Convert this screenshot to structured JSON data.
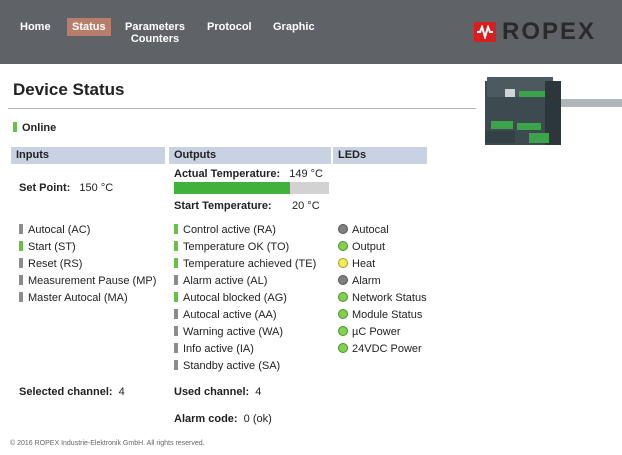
{
  "nav": {
    "items": [
      {
        "label": "Home",
        "active": false
      },
      {
        "label": "Status",
        "active": true
      },
      {
        "label": "Parameters\nCounters",
        "active": false
      },
      {
        "label": "Protocol",
        "active": false
      },
      {
        "label": "Graphic",
        "active": false
      }
    ]
  },
  "brand": {
    "logo_text": "ROPEX",
    "logo_color": "#d81e1e"
  },
  "page": {
    "title": "Device Status",
    "online_label": "Online"
  },
  "columns": {
    "inputs": "Inputs",
    "outputs": "Outputs",
    "leds": "LEDs"
  },
  "setpoint": {
    "label": "Set Point:",
    "value": "150 °C"
  },
  "temperature": {
    "actual_label": "Actual Temperature:",
    "actual_value": "149 °C",
    "start_label": "Start Temperature:",
    "start_value": "20 °C",
    "bar_fraction": 0.75
  },
  "inputs": [
    {
      "label": "Autocal (AC)",
      "state": "gray"
    },
    {
      "label": "Start (ST)",
      "state": "green"
    },
    {
      "label": "Reset (RS)",
      "state": "gray"
    },
    {
      "label": "Measurement Pause (MP)",
      "state": "gray"
    },
    {
      "label": "Master Autocal (MA)",
      "state": "gray"
    }
  ],
  "outputs": [
    {
      "label": "Control active (RA)",
      "state": "green"
    },
    {
      "label": "Temperature OK (TO)",
      "state": "green"
    },
    {
      "label": "Temperature achieved (TE)",
      "state": "green"
    },
    {
      "label": "Alarm active (AL)",
      "state": "gray"
    },
    {
      "label": "Autocal blocked (AG)",
      "state": "green"
    },
    {
      "label": "Autocal active (AA)",
      "state": "gray"
    },
    {
      "label": "Warning active (WA)",
      "state": "gray"
    },
    {
      "label": "Info active (IA)",
      "state": "gray"
    },
    {
      "label": "Standby active (SA)",
      "state": "gray"
    }
  ],
  "leds": [
    {
      "label": "Autocal",
      "color": "#7f7f7f"
    },
    {
      "label": "Output",
      "color": "#7dd34a"
    },
    {
      "label": "Heat",
      "color": "#f2ee52"
    },
    {
      "label": "Alarm",
      "color": "#7f7f7f"
    },
    {
      "label": "Network Status",
      "color": "#7dd34a"
    },
    {
      "label": "Module Status",
      "color": "#7dd34a"
    },
    {
      "label": "µC Power",
      "color": "#7dd34a"
    },
    {
      "label": "24VDC Power",
      "color": "#7dd34a"
    }
  ],
  "channels": {
    "selected_label": "Selected channel:",
    "selected_value": "4",
    "used_label": "Used channel:",
    "used_value": "4",
    "alarm_label": "Alarm code:",
    "alarm_value": "0 (ok)"
  },
  "footer": {
    "text": "© 2016 ROPEX Industrie-Elektronik GmbH. All rights reserved."
  }
}
